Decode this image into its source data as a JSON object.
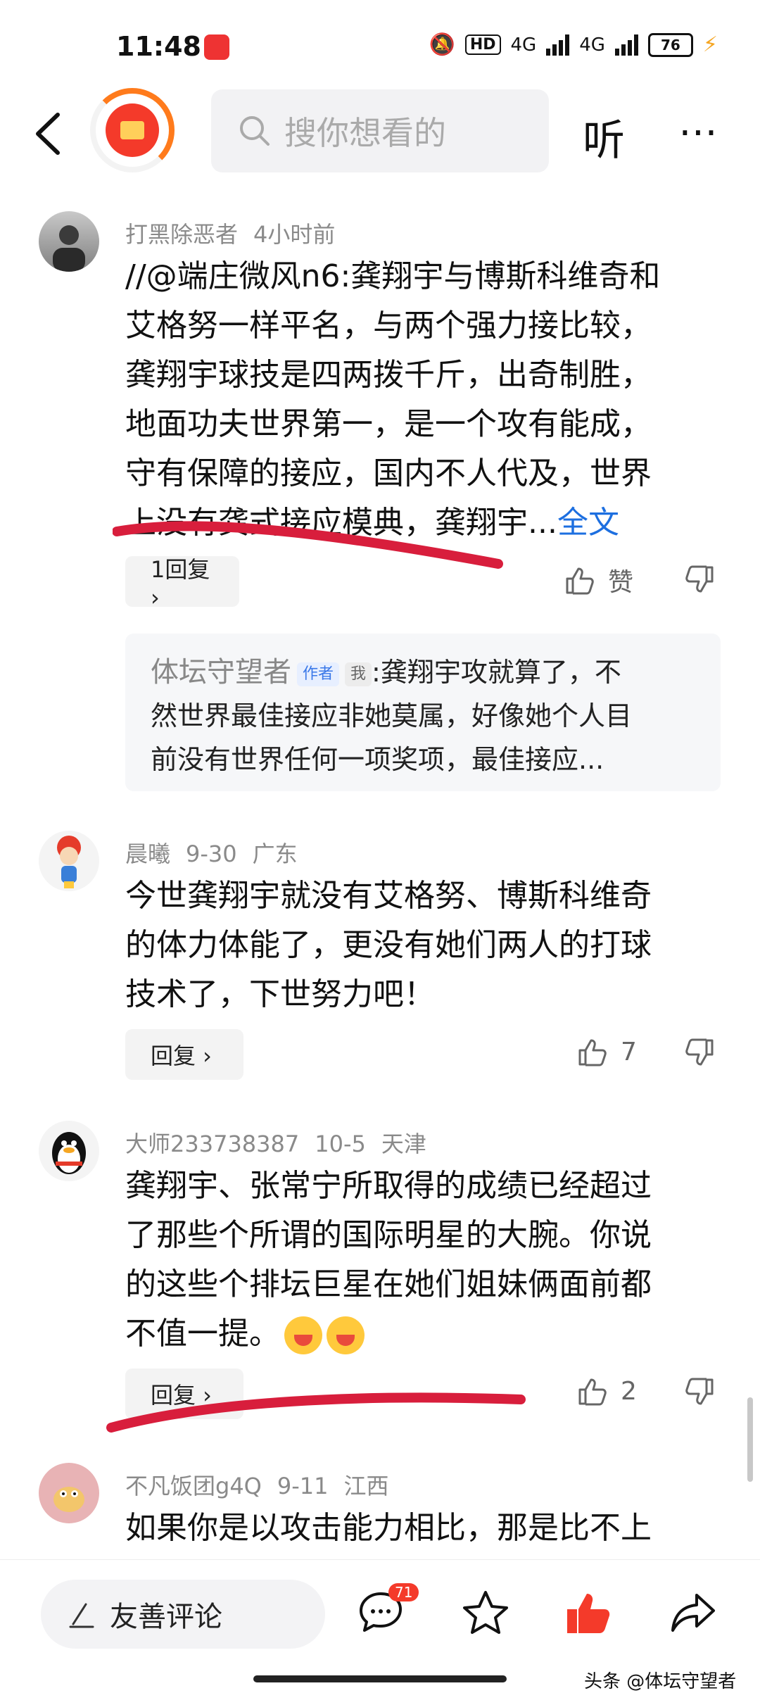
{
  "status_bar": {
    "time": "11:48",
    "hd": "HD",
    "net1": "4G",
    "net2": "4G",
    "battery": "76"
  },
  "top_nav": {
    "search_placeholder": "搜你想看的",
    "listen_label": "听",
    "more_label": "⋯"
  },
  "comments": [
    {
      "user": "打黑除恶者",
      "time": "4小时前",
      "location": "",
      "lines": [
        "//@端庄微风n6:龚翔宇与博斯科维奇和",
        "艾格努一样平名，与两个强力接比较，",
        "龚翔宇球技是四两拨千斤，出奇制胜，",
        "地面功夫世界第一，是一个攻有能成，",
        "守有保障的接应，国内不人代及，世界",
        "上没有龚式接应模典，龚翔宇..."
      ],
      "full_text_link": "全文",
      "reply_button": "1回复 ›",
      "like_label": "赞",
      "sub_reply": {
        "name": "体坛守望者",
        "tag_author": "作者",
        "tag_me": "我",
        "lines": [
          ":龚翔宇攻就算了，不",
          "然世界最佳接应非她莫属，好像她个人目",
          "前没有世界任何一项奖项，最佳接应..."
        ]
      }
    },
    {
      "user": "晨曦",
      "time": "9-30",
      "location": "广东",
      "lines": [
        "今世龚翔宇就没有艾格努、博斯科维奇",
        "的体力体能了，更没有她们两人的打球",
        "技术了，下世努力吧！"
      ],
      "reply_button": "回复 ›",
      "like_count": "7"
    },
    {
      "user": "大师233738387",
      "time": "10-5",
      "location": "天津",
      "lines": [
        "龚翔宇、张常宁所取得的成绩已经超过",
        "了那些个所谓的国际明星的大腕。你说",
        "的这些个排坛巨星在她们姐妹俩面前都",
        "不值一提。"
      ],
      "reply_button": "回复 ›",
      "like_count": "2"
    },
    {
      "user": "不凡饭团g4Q",
      "time": "9-11",
      "location": "江西",
      "lines": [
        "如果你是以攻击能力相比，那是比不上"
      ]
    }
  ],
  "bottom_bar": {
    "comment_placeholder": "友善评论",
    "comment_count_badge": "71"
  },
  "watermark": "头条 @体坛守望者",
  "colors": {
    "link_blue": "#1d6fe0",
    "like_red": "#f43a2a",
    "underline_red": "#d81e3c",
    "redpacket_ring": "#ff7b1c"
  }
}
